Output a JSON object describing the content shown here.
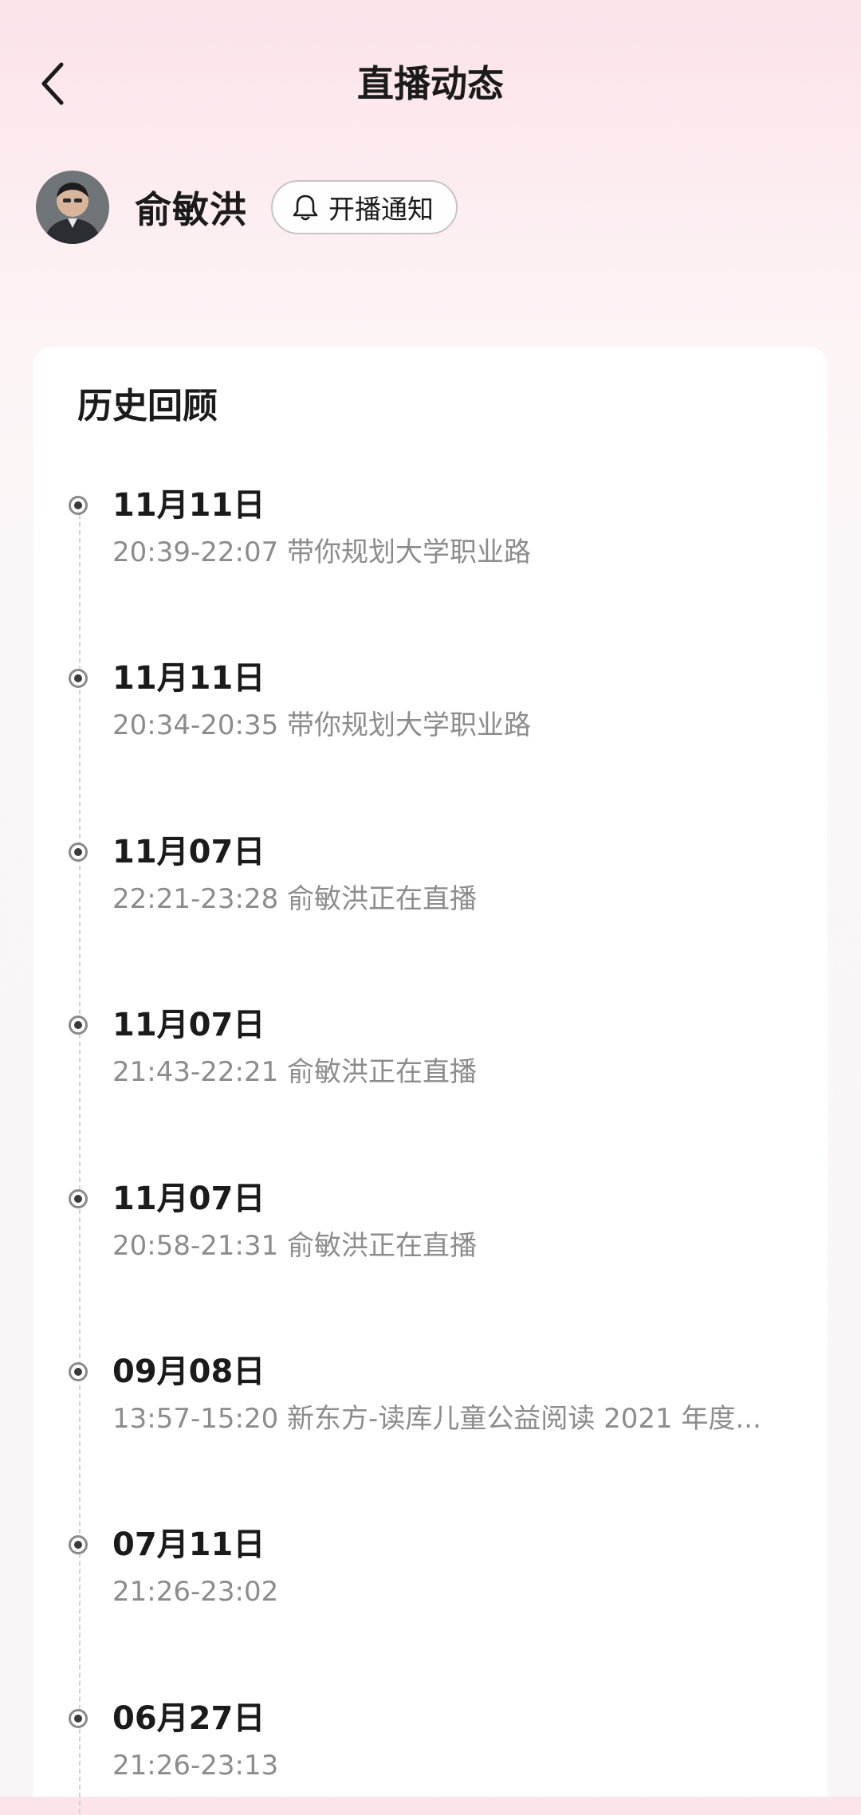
{
  "header": {
    "back_icon": "chevron-left-icon",
    "title": "直播动态"
  },
  "profile": {
    "avatar_icon": "avatar",
    "name": "俞敏洪",
    "notify_icon": "bell-icon",
    "notify_label": "开播通知"
  },
  "history": {
    "title": "历史回顾",
    "entries": [
      {
        "date": "11月11日",
        "time": "20:39-22:07",
        "topic": "带你规划大学职业路"
      },
      {
        "date": "11月11日",
        "time": "20:34-20:35",
        "topic": "带你规划大学职业路"
      },
      {
        "date": "11月07日",
        "time": "22:21-23:28",
        "topic": "俞敏洪正在直播"
      },
      {
        "date": "11月07日",
        "time": "21:43-22:21",
        "topic": "俞敏洪正在直播"
      },
      {
        "date": "11月07日",
        "time": "20:58-21:31",
        "topic": "俞敏洪正在直播"
      },
      {
        "date": "09月08日",
        "time": "13:57-15:20",
        "topic": "新东方-读库儿童公益阅读 2021 年度..."
      },
      {
        "date": "07月11日",
        "time": "21:26-23:02",
        "topic": ""
      },
      {
        "date": "06月27日",
        "time": "21:26-23:13",
        "topic": ""
      }
    ]
  },
  "colors": {
    "title_text": "#1b1b1b",
    "detail_text": "#8c8c8c",
    "background_top": "#fbe3ea",
    "card": "#ffffff"
  }
}
